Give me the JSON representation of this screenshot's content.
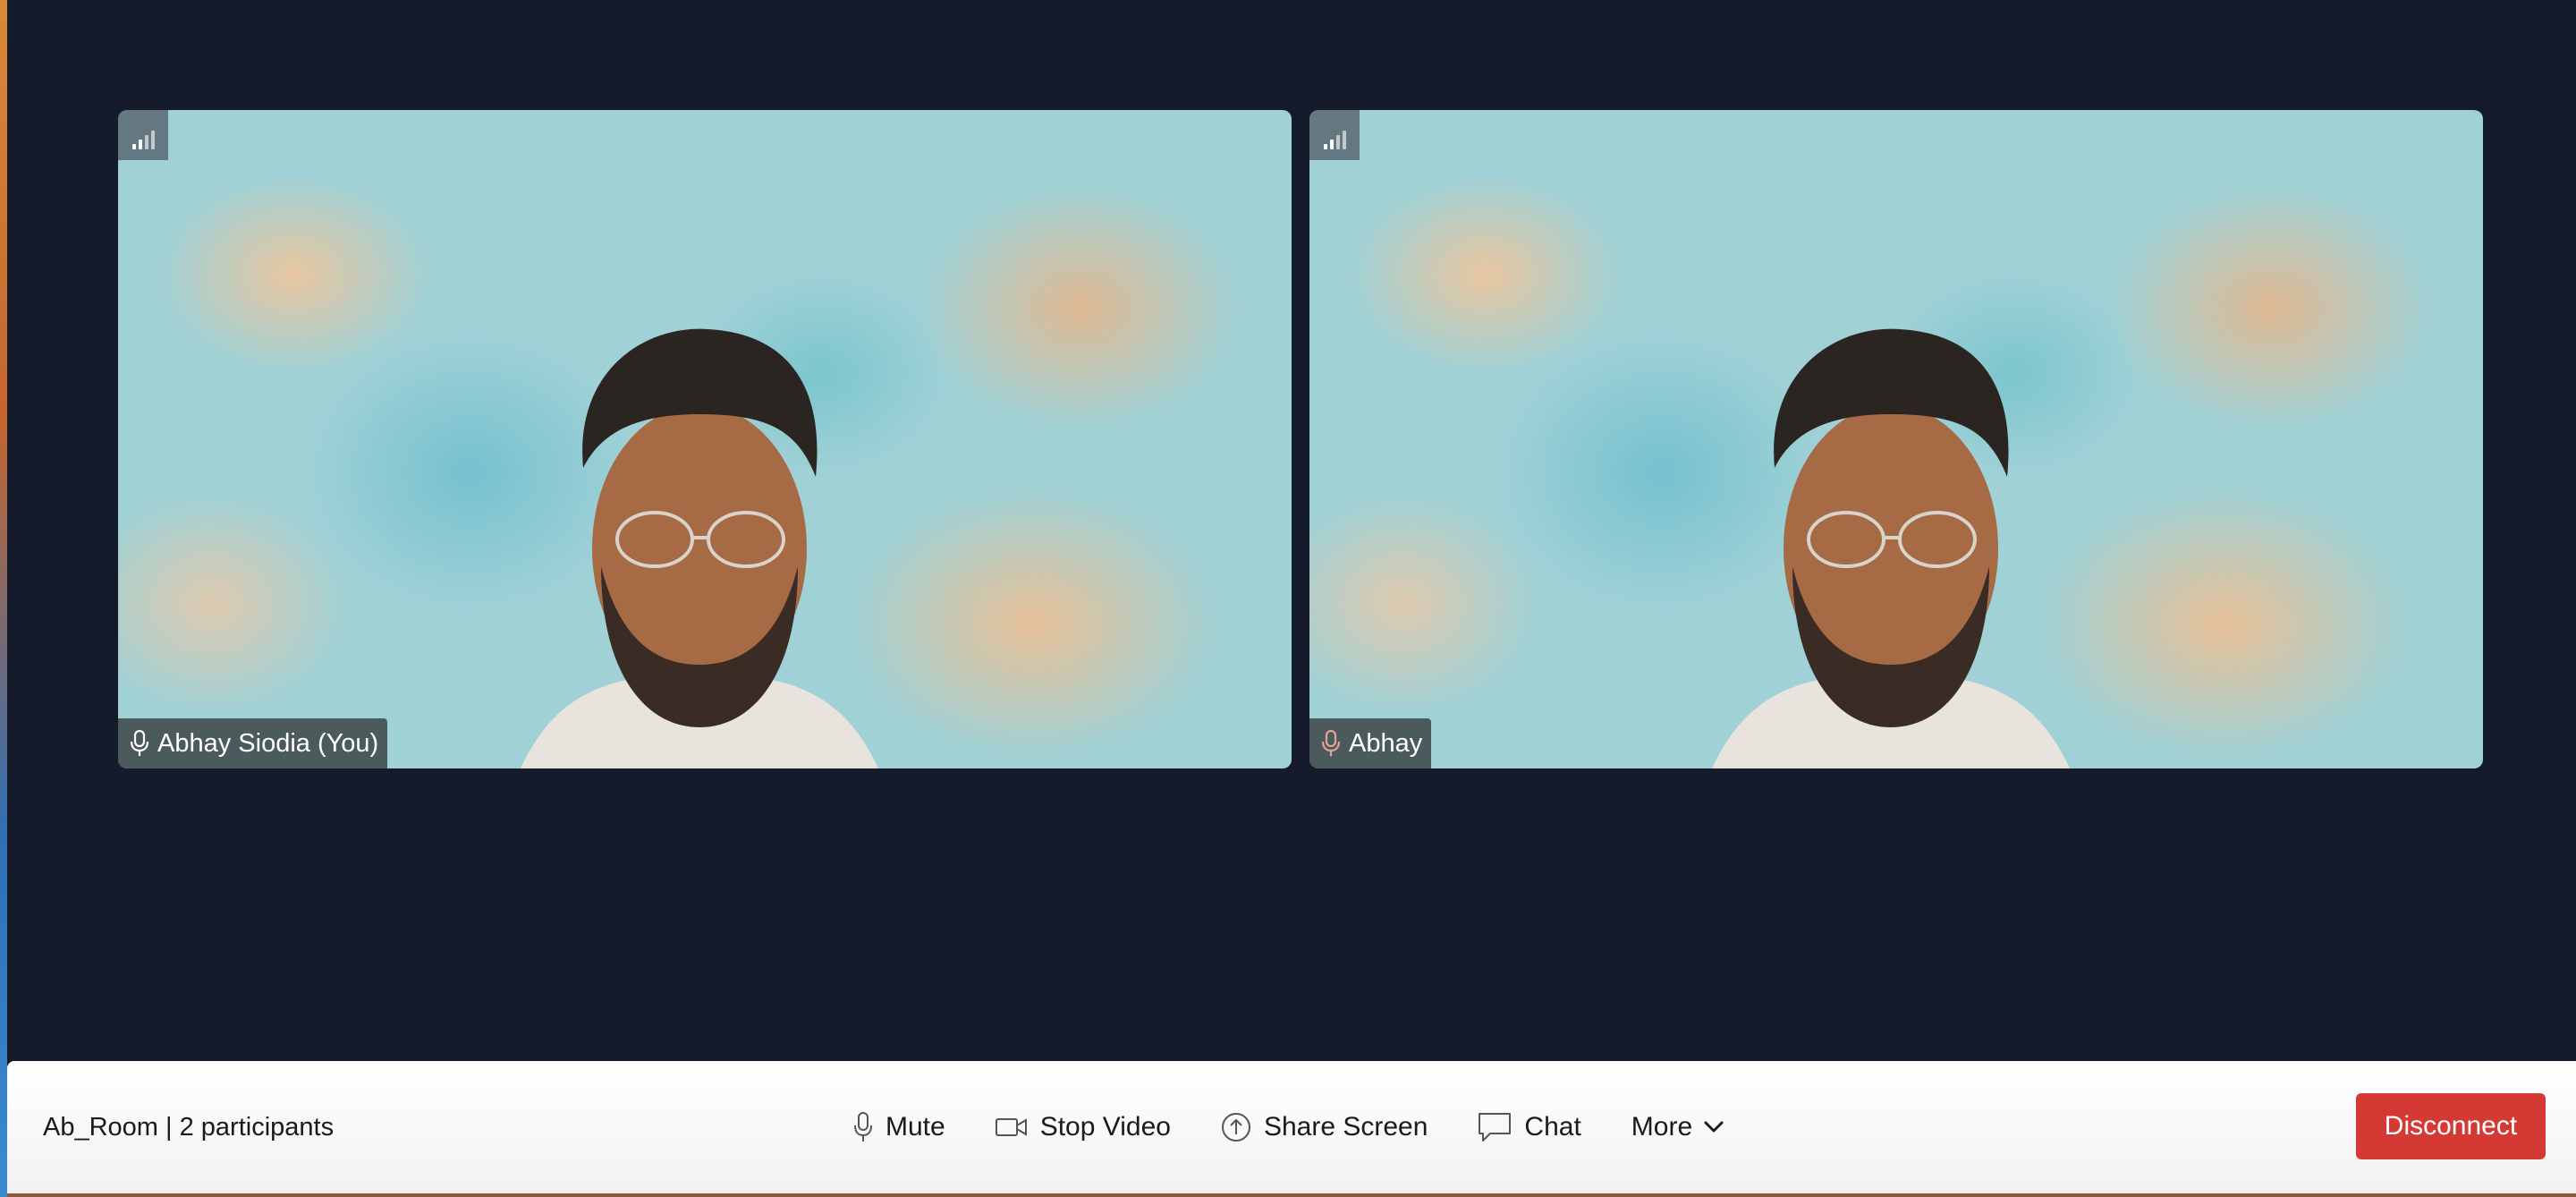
{
  "participants": [
    {
      "name": "Abhay Siodia (You)",
      "mic_color": "#ffffff"
    },
    {
      "name": "Abhay",
      "mic_color": "#e8a090"
    }
  ],
  "toolbar": {
    "room_info": "Ab_Room | 2 participants",
    "mute_label": "Mute",
    "stop_video_label": "Stop Video",
    "share_screen_label": "Share Screen",
    "chat_label": "Chat",
    "more_label": "More",
    "disconnect_label": "Disconnect"
  },
  "icons": {
    "signal": "signal-strength-icon",
    "mic": "microphone-icon",
    "video": "video-camera-icon",
    "share": "share-screen-icon",
    "chat": "chat-bubble-icon",
    "more": "chevron-down-icon"
  },
  "colors": {
    "stage_background": "#151b2a",
    "disconnect": "#d43a33",
    "toolbar": "#ffffff"
  }
}
